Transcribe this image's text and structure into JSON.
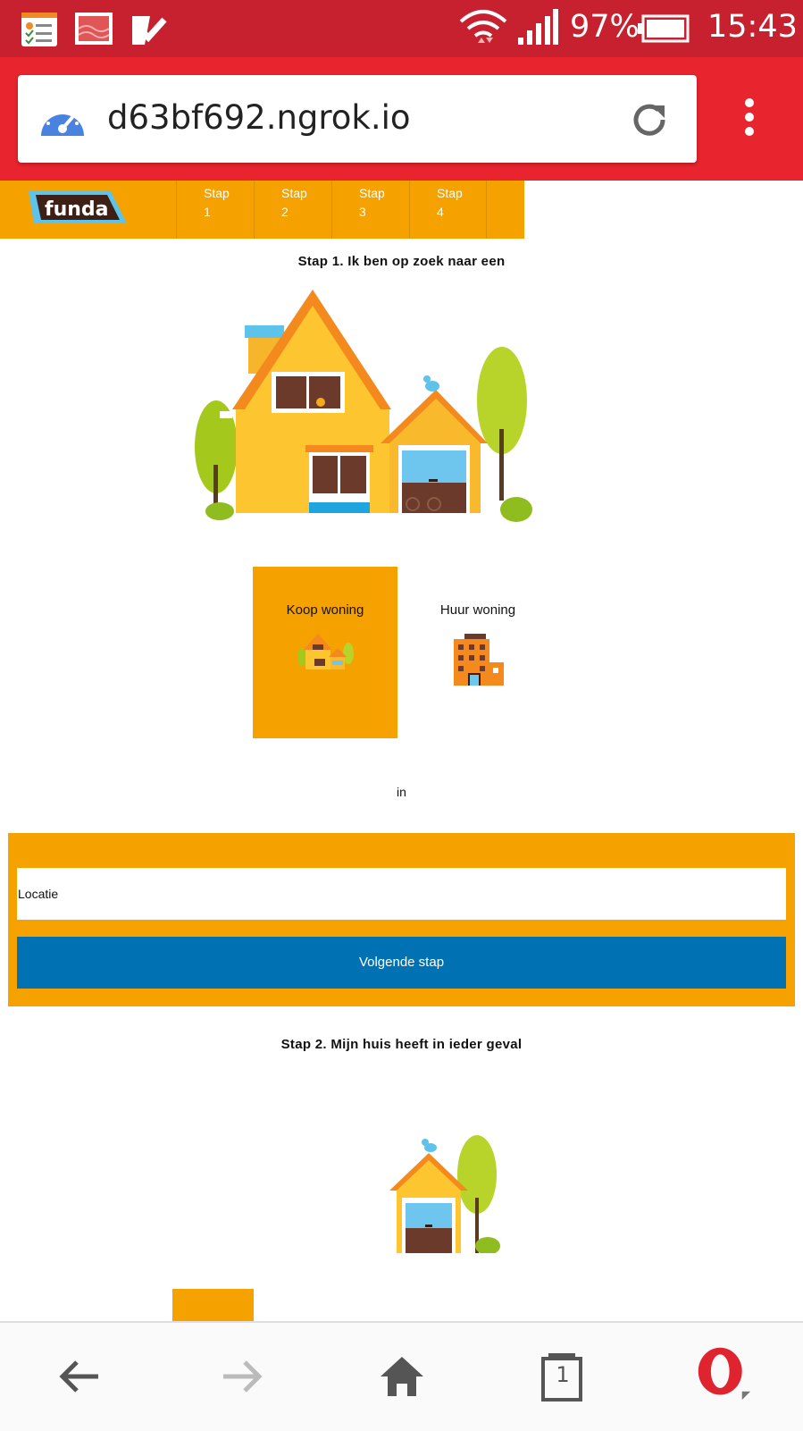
{
  "status_bar": {
    "battery": "97%",
    "time": "15:43"
  },
  "browser": {
    "url": "d63bf692.ngrok.io",
    "tab_count": "1"
  },
  "site": {
    "logo_text": "funda",
    "steps": [
      {
        "label": "Stap",
        "number": "1"
      },
      {
        "label": "Stap",
        "number": "2"
      },
      {
        "label": "Stap",
        "number": "3"
      },
      {
        "label": "Stap",
        "number": "4"
      }
    ]
  },
  "step1": {
    "heading": "Stap 1. Ik ben op zoek naar een",
    "options": [
      {
        "label": "Koop woning",
        "selected": true
      },
      {
        "label": "Huur woning",
        "selected": false
      }
    ],
    "in_text": "in",
    "location_placeholder": "Locatie",
    "next_button": "Volgende stap"
  },
  "step2": {
    "heading": "Stap 2. Mijn huis heeft in ieder geval"
  },
  "colors": {
    "status_bar": "#c7202f",
    "browser_bar": "#e8242e",
    "funda_orange": "#f5a200",
    "button_blue": "#0071b3"
  }
}
